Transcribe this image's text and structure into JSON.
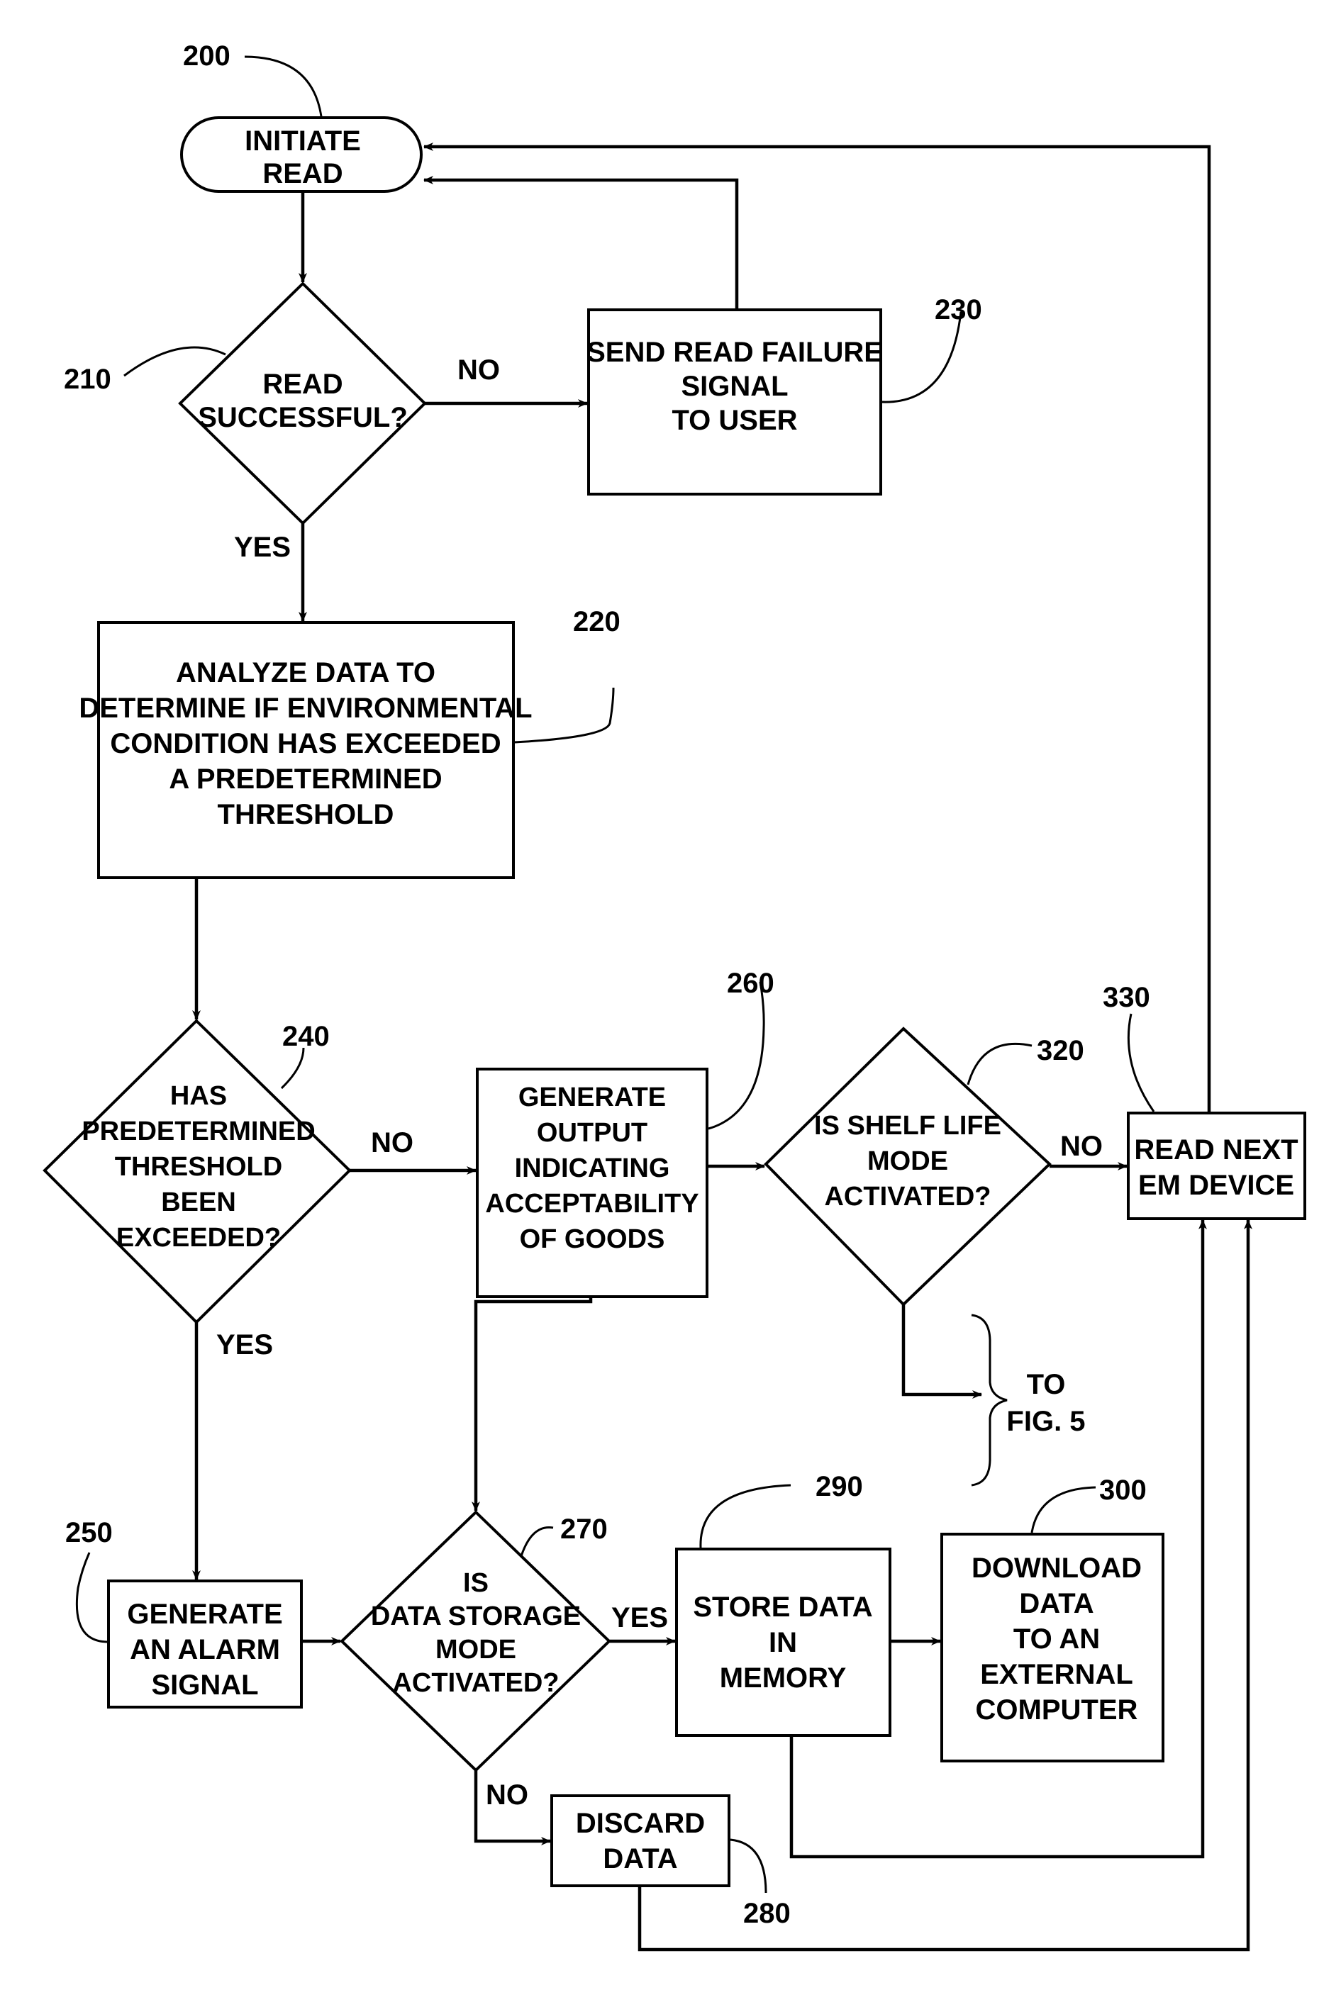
{
  "figure": {
    "nodes": {
      "n200": {
        "ref": "200",
        "lines": [
          "INITIATE",
          "READ"
        ]
      },
      "n210": {
        "ref": "210",
        "lines": [
          "READ",
          "SUCCESSFUL?"
        ]
      },
      "n230": {
        "ref": "230",
        "lines": [
          "SEND READ FAILURE",
          "SIGNAL",
          "TO USER"
        ]
      },
      "n220": {
        "ref": "220",
        "lines": [
          "ANALYZE DATA TO",
          "DETERMINE IF ENVIRONMENTAL",
          "CONDITION HAS EXCEEDED",
          "A PREDETERMINED",
          "THRESHOLD"
        ]
      },
      "n240": {
        "ref": "240",
        "lines": [
          "HAS",
          "PREDETERMINED",
          "THRESHOLD",
          "BEEN",
          "EXCEEDED?"
        ]
      },
      "n260": {
        "ref": "260",
        "lines": [
          "GENERATE",
          "OUTPUT",
          "INDICATING",
          "ACCEPTABILITY",
          "OF GOODS"
        ]
      },
      "n320": {
        "ref": "320",
        "lines": [
          "IS SHELF LIFE",
          "MODE",
          "ACTIVATED?"
        ]
      },
      "n330": {
        "ref": "330",
        "lines": [
          "READ NEXT",
          "EM DEVICE"
        ]
      },
      "n250": {
        "ref": "250",
        "lines": [
          "GENERATE",
          "AN ALARM",
          "SIGNAL"
        ]
      },
      "n270": {
        "ref": "270",
        "lines": [
          "IS",
          "DATA STORAGE",
          "MODE",
          "ACTIVATED?"
        ]
      },
      "n290": {
        "ref": "290",
        "lines": [
          "STORE DATA",
          "IN",
          "MEMORY"
        ]
      },
      "n300": {
        "ref": "300",
        "lines": [
          "DOWNLOAD",
          "DATA",
          "TO AN",
          "EXTERNAL",
          "COMPUTER"
        ]
      },
      "n280": {
        "ref": "280",
        "lines": [
          "DISCARD",
          "DATA"
        ]
      }
    },
    "edge_labels": {
      "e210_no": "NO",
      "e210_yes": "YES",
      "e240_no": "NO",
      "e240_yes": "YES",
      "e320_no": "NO",
      "e270_yes": "YES",
      "e270_no": "NO"
    },
    "offpage": {
      "lines": [
        "TO",
        "FIG. 5"
      ]
    }
  }
}
